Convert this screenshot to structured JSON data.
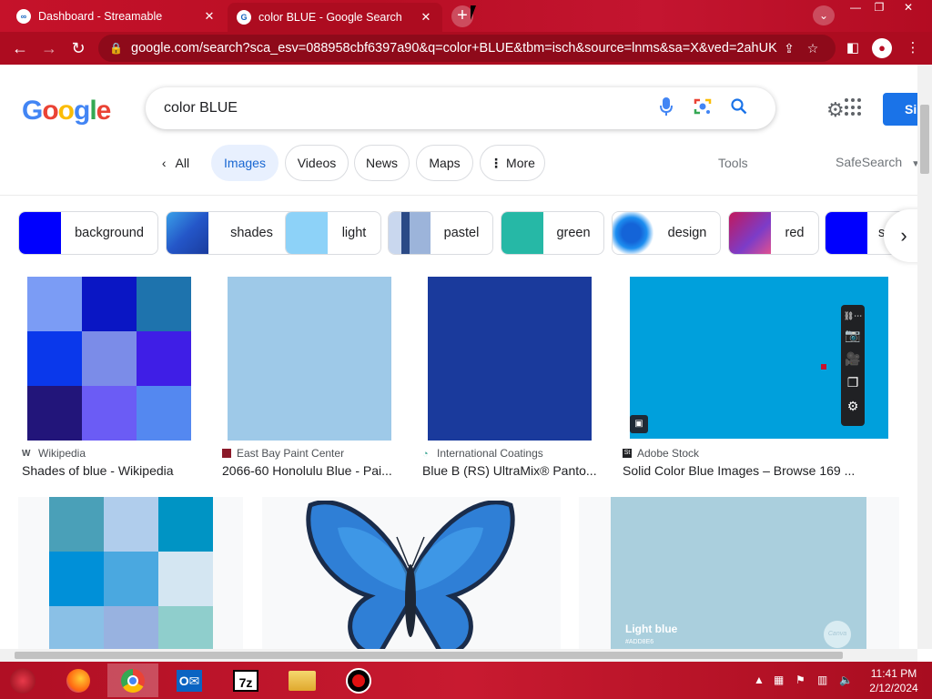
{
  "browser": {
    "tabs": [
      {
        "title": "Dashboard - Streamable",
        "favicon": "∞"
      },
      {
        "title": "color BLUE - Google Search",
        "favicon": "G"
      }
    ],
    "url": "google.com/search?sca_esv=088958cbf6397a90&q=color+BLUE&tbm=isch&source=lnms&sa=X&ved=2ahUKE..."
  },
  "google": {
    "logo": [
      "G",
      "o",
      "o",
      "g",
      "l",
      "e"
    ],
    "query": "color BLUE",
    "signin_label": "Si",
    "nav": [
      "All",
      "Images",
      "Videos",
      "News",
      "Maps",
      "More"
    ],
    "tools": "Tools",
    "safesearch": "SafeSearch"
  },
  "chips": [
    {
      "label": "background"
    },
    {
      "label": "shades"
    },
    {
      "label": "light"
    },
    {
      "label": "pastel"
    },
    {
      "label": "green"
    },
    {
      "label": "design"
    },
    {
      "label": "red"
    },
    {
      "label": "s"
    }
  ],
  "results": [
    {
      "source": "Wikipedia",
      "caption": "Shades of blue - Wikipedia"
    },
    {
      "source": "East Bay Paint Center",
      "caption": "2066-60 Honolulu Blue - Pai..."
    },
    {
      "source": "International Coatings",
      "caption": "Blue B (RS) UltraMix® Panto..."
    },
    {
      "source": "Adobe Stock",
      "caption": "Solid Color Blue Images – Browse 169 ..."
    }
  ],
  "second_row": {
    "light_blue_label": "Light blue",
    "light_blue_code": "#ADD8E6",
    "canva_badge": "Canva"
  },
  "taskbar": {
    "time": "11:41 PM",
    "date": "2/12/2024",
    "seven_zip": "7z"
  },
  "colors": {
    "chrome_red": "#b80e24",
    "google_blue": "#1a73e8"
  }
}
